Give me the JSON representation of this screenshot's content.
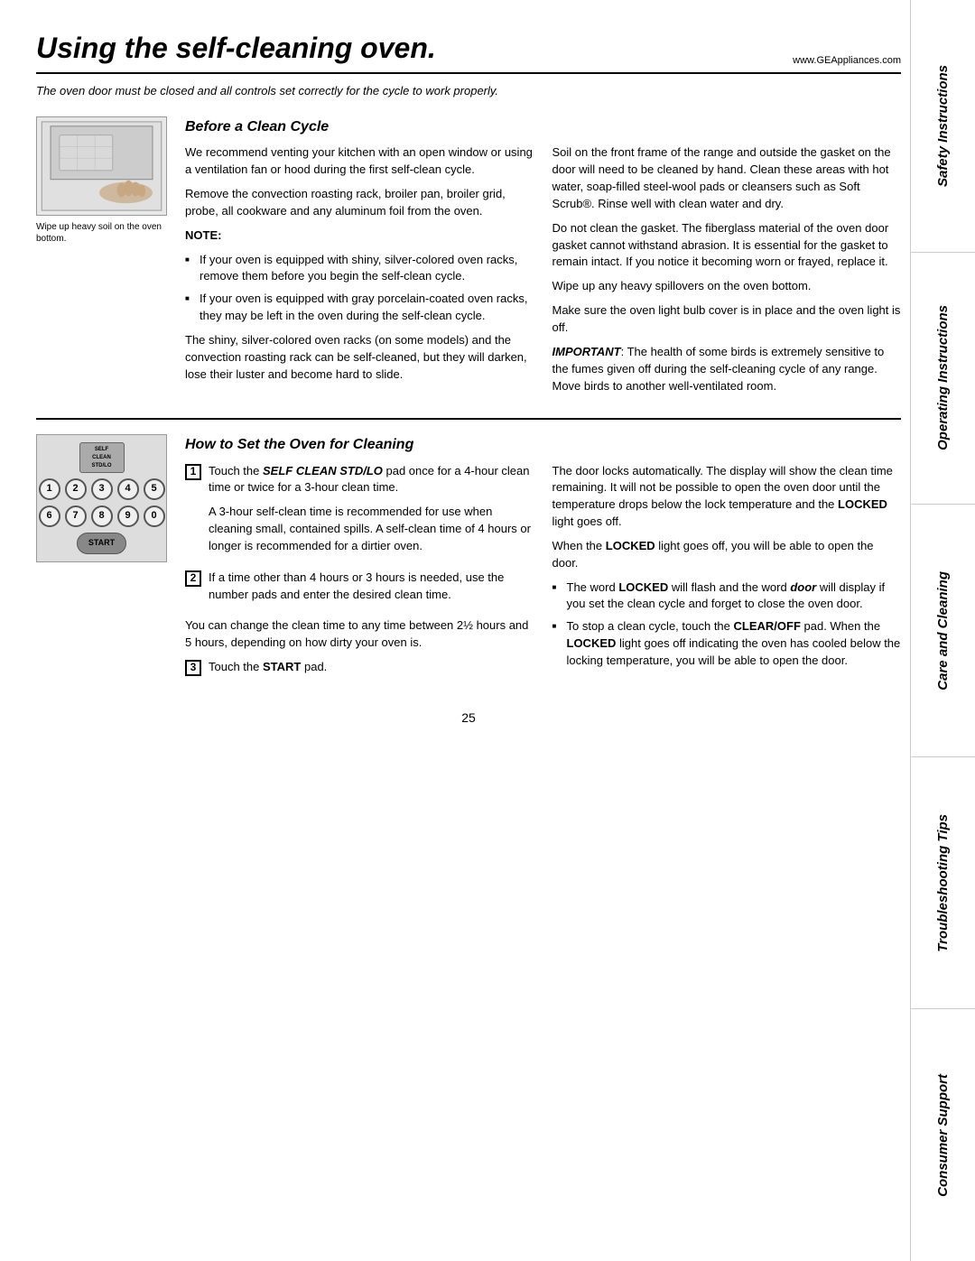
{
  "page": {
    "title": "Using the self-cleaning oven.",
    "website": "www.GEAppliances.com",
    "subtitle": "The oven door must be closed and all controls set correctly for the cycle to work properly.",
    "page_number": "25"
  },
  "sidebar": {
    "sections": [
      {
        "label": "Safety Instructions",
        "id": "safety"
      },
      {
        "label": "Operating Instructions",
        "id": "operating"
      },
      {
        "label": "Care and Cleaning",
        "id": "care"
      },
      {
        "label": "Troubleshooting Tips",
        "id": "troubleshooting"
      },
      {
        "label": "Consumer Support",
        "id": "consumer"
      }
    ]
  },
  "image_caption": "Wipe up heavy soil on the oven bottom.",
  "before_clean": {
    "heading": "Before a Clean Cycle",
    "col1": {
      "p1": "We recommend venting your kitchen with an open window or using a ventilation fan or hood during the first self-clean cycle.",
      "p2": "Remove the convection roasting rack, broiler pan, broiler grid, probe, all cookware and any aluminum foil from the oven.",
      "note_label": "NOTE:",
      "note_items": [
        "If your oven is equipped with shiny, silver-colored oven racks, remove them before you begin the self-clean cycle.",
        "If your oven is equipped with gray porcelain-coated oven racks, they may be left in the oven during the self-clean cycle."
      ],
      "p3": "The shiny, silver-colored oven racks (on some models) and the convection roasting rack can be self-cleaned, but they will darken, lose their luster and become hard to slide."
    },
    "col2": {
      "p1": "Soil on the front frame of the range and outside the gasket on the door will need to be cleaned by hand. Clean these areas with hot water, soap-filled steel-wool pads or cleansers such as Soft Scrub®. Rinse well with clean water and dry.",
      "p2": "Do not clean the gasket. The fiberglass material of the oven door gasket cannot withstand abrasion. It is essential for the gasket to remain intact. If you notice it becoming worn or frayed, replace it.",
      "p3": "Wipe up any heavy spillovers on the oven bottom.",
      "p4": "Make sure the oven light bulb cover is in place and the oven light is off.",
      "p5_bold": "IMPORTANT",
      "p5": ": The health of some birds is extremely sensitive to the fumes given off during the self-cleaning cycle of any range. Move birds to another well-ventilated room."
    }
  },
  "how_to_set": {
    "heading": "How to Set the Oven for Cleaning",
    "step1": {
      "number": "1",
      "text_bold": "SELF CLEAN STD/LO",
      "text": " pad once for a 4-hour clean time or twice for a 3-hour clean time.",
      "prefix": "Touch the ",
      "sub_text": "A 3-hour self-clean time is recommended for use when cleaning small, contained spills. A self-clean time of 4 hours or longer is recommended for a dirtier oven."
    },
    "step2": {
      "number": "2",
      "text": "If a time other than 4 hours or 3 hours is needed, use the number pads and enter the desired clean time."
    },
    "change_time": "You can change the clean time to any time between 2½ hours and 5 hours, depending on how dirty your oven is.",
    "step3": {
      "number": "3",
      "text_prefix": "Touch the ",
      "text_bold": "START",
      "text_suffix": " pad."
    },
    "col2": {
      "p1": "The door locks automatically. The display will show the clean time remaining. It will not be possible to open the oven door until the temperature drops below the lock temperature and the ",
      "p1_bold": "LOCKED",
      "p1_suffix": " light goes off.",
      "p2_prefix": "When the ",
      "p2_bold": "LOCKED",
      "p2_suffix": " light goes off, you will be able to open the door.",
      "bullets": [
        {
          "text_prefix": "The word ",
          "text_bold": "LOCKED",
          "text_suffix": " will flash and the word ",
          "text_bold2": "door",
          "text_suffix2": " will display if you set the clean cycle and forget to close the oven door."
        },
        {
          "text_prefix": "To stop a clean cycle, touch the ",
          "text_bold": "CLEAR/OFF",
          "text_middle": " pad. When the ",
          "text_bold2": "LOCKED",
          "text_suffix": " light goes off indicating the oven has cooled below the locking temperature, you will be able to open the door."
        }
      ]
    }
  },
  "keypad": {
    "self_clean_label": "SELF CLEAN STD/LO",
    "keys_row1": [
      "1",
      "2",
      "3",
      "4",
      "5"
    ],
    "keys_row2": [
      "6",
      "7",
      "8",
      "9",
      "0"
    ],
    "start_label": "START"
  }
}
